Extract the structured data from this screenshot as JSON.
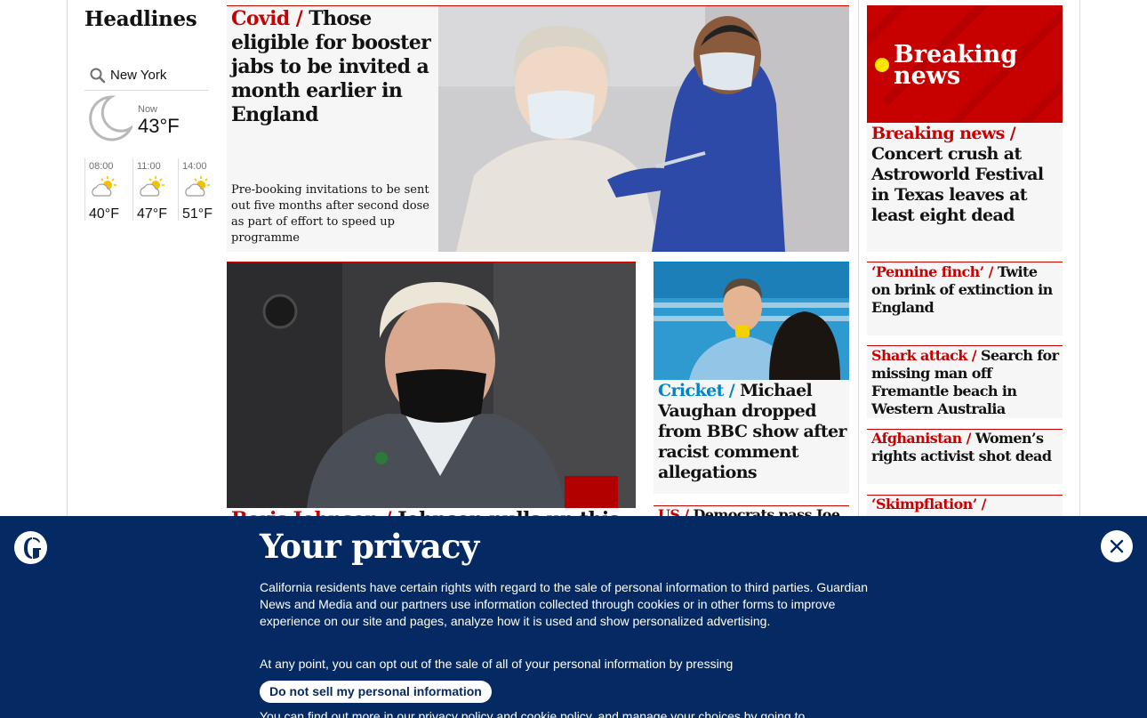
{
  "left": {
    "headlines_title": "Headlines",
    "weather": {
      "location": "New York",
      "now_label": "Now",
      "now_temp": "43°F",
      "now_icon": "crescent-moon-icon",
      "forecast": [
        {
          "time": "08:00",
          "temp": "40°F",
          "icon": "sun-behind-cloud-icon"
        },
        {
          "time": "11:00",
          "temp": "47°F",
          "icon": "sun-behind-cloud-icon"
        },
        {
          "time": "14:00",
          "temp": "51°F",
          "icon": "sun-behind-cloud-icon"
        }
      ]
    }
  },
  "stories": {
    "covid": {
      "kicker": "Covid /",
      "title": "Those eligible for booster jabs to be invited a month earlier in England",
      "standfirst": "Pre-booking invitations to be sent out five months after second dose as part of effort to speed up programme"
    },
    "breaking": {
      "image_text_1": "Breaking",
      "image_text_2": "news",
      "kicker": "Breaking news /",
      "title": "Concert crush at Astroworld Festival in Texas leaves at least eight dead"
    },
    "johnson": {
      "kicker": "Boris Johnson /",
      "title": "Johnson pulls up this"
    },
    "cricket": {
      "kicker": "Cricket /",
      "title": "Michael Vaughan dropped from BBC show after racist comment allegations"
    },
    "us": {
      "kicker": "US /",
      "title": "Democrats pass Joe"
    },
    "side_list": [
      {
        "kicker": "‘Pennine finch’ /",
        "title": "Twite on brink of extinction in England"
      },
      {
        "kicker": "Shark attack /",
        "title": "Search for missing man off Fremantle beach in Western Australia"
      },
      {
        "kicker": "Afghanistan /",
        "title": "Women’s rights activist shot dead"
      },
      {
        "kicker": "‘Skimpflation’ /",
        "title": ""
      }
    ]
  },
  "privacy": {
    "title": "Your privacy",
    "body": "California residents have certain rights with regard to the sale of personal information to third parties. Guardian News and Media and our partners use information collected through cookies or in other forms to improve experience on our site and pages, analyze how it is used and show personalized advertising.",
    "body2": "At any point, you can opt out of the sale of all of your personal information by pressing",
    "button": "Do not sell my personal information",
    "body3": "You can find out more in our privacy policy and cookie policy, and manage your choices by going to",
    "logo_icon": "guardian-logo-icon",
    "close_icon": "close-icon"
  },
  "colors": {
    "brand_navy": "#052962",
    "news_red": "#c70000",
    "sport_blue": "#0084c6"
  }
}
